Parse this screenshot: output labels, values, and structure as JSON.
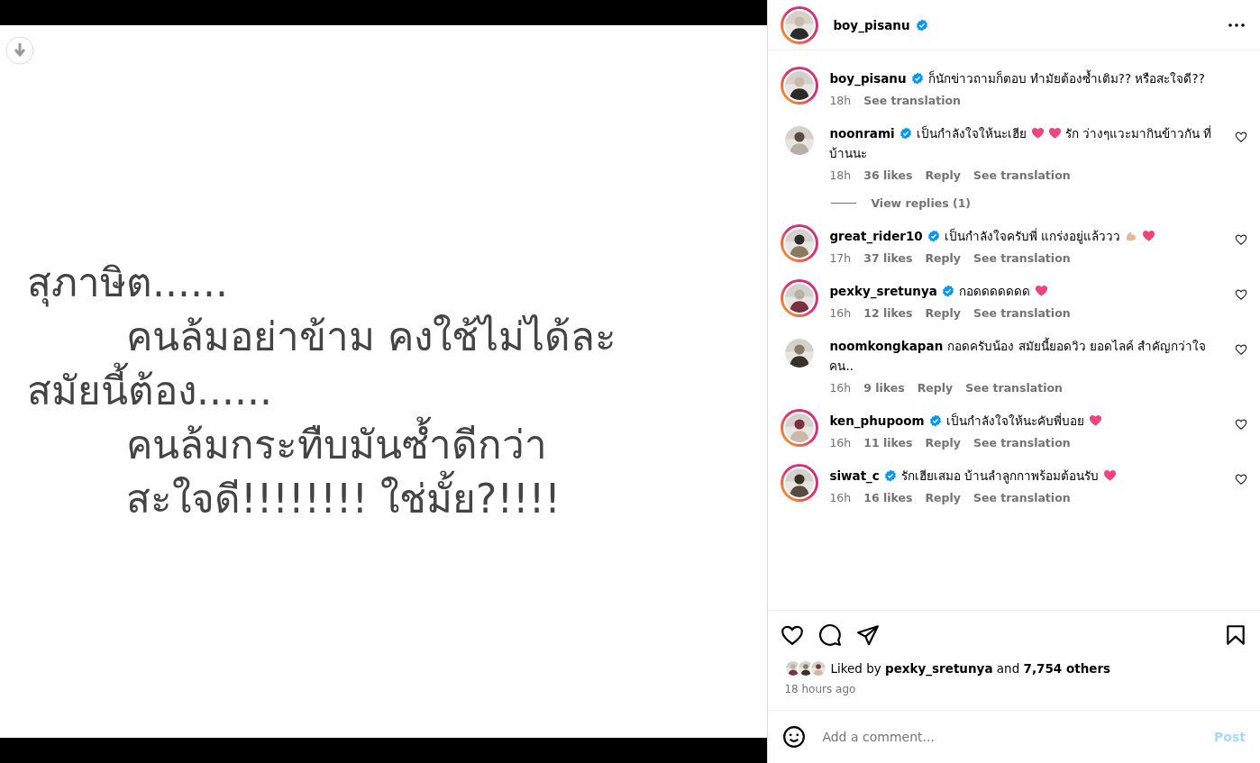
{
  "post_image": {
    "lines": [
      {
        "text": "สุภาษิต......",
        "indent": false
      },
      {
        "text": "คนล้มอย่าข้าม คงใช้ไม่ได้ละ",
        "indent": true
      },
      {
        "text": "สมัยนี้ต้อง......",
        "indent": false
      },
      {
        "text": "คนล้มกระทืบมันซ้ำดีกว่า",
        "indent": true
      },
      {
        "text": "สะใจดี!!!!!!!! ใช่มั้ย?!!!!",
        "indent": true
      }
    ]
  },
  "header": {
    "username": "boy_pisanu",
    "verified": true,
    "story_ring": true
  },
  "caption": {
    "username": "boy_pisanu",
    "verified": true,
    "story_ring": true,
    "parts": [
      {
        "kind": "text",
        "text": "ก็นักข่าวถามก็ตอบ ทำมัยต้องซ้ำเติม?? หรือสะใจดี??"
      }
    ],
    "time": "18h",
    "see_translation": "See translation"
  },
  "comments": [
    {
      "username": "noonrami",
      "verified": true,
      "story_ring": false,
      "parts": [
        {
          "kind": "text",
          "text": "เป็นกำลังใจให้นะเฮีย"
        },
        {
          "kind": "heart"
        },
        {
          "kind": "heart"
        },
        {
          "kind": "text",
          "text": "รัก ว่างๆแวะมากินข้าวกัน ที่บ้านนะ"
        }
      ],
      "time": "18h",
      "likes": "36 likes",
      "reply": "Reply",
      "see_translation": "See translation",
      "view_replies": "View replies (1)"
    },
    {
      "username": "great_rider10",
      "verified": true,
      "story_ring": true,
      "parts": [
        {
          "kind": "text",
          "text": "เป็นกำลังใจครับพี่ แกร่งอยู่แล้ววว"
        },
        {
          "kind": "muscle"
        },
        {
          "kind": "heart"
        }
      ],
      "time": "17h",
      "likes": "37 likes",
      "reply": "Reply",
      "see_translation": "See translation"
    },
    {
      "username": "pexky_sretunya",
      "verified": true,
      "story_ring": true,
      "parts": [
        {
          "kind": "text",
          "text": "กอดดดดดดด"
        },
        {
          "kind": "heart"
        }
      ],
      "time": "16h",
      "likes": "12 likes",
      "reply": "Reply",
      "see_translation": "See translation"
    },
    {
      "username": "noomkongkapan",
      "verified": false,
      "story_ring": false,
      "parts": [
        {
          "kind": "text",
          "text": "กอดครับน้อง สมัยนี้ยอดวิว ยอดไลค์ สำคัญกว่าใจคน.."
        }
      ],
      "time": "16h",
      "likes": "9 likes",
      "reply": "Reply",
      "see_translation": "See translation"
    },
    {
      "username": "ken_phupoom",
      "verified": true,
      "story_ring": true,
      "parts": [
        {
          "kind": "text",
          "text": "เป็นกำลังใจให้นะคับพี่บอย"
        },
        {
          "kind": "heart"
        }
      ],
      "time": "16h",
      "likes": "11 likes",
      "reply": "Reply",
      "see_translation": "See translation"
    },
    {
      "username": "siwat_c",
      "verified": true,
      "story_ring": true,
      "parts": [
        {
          "kind": "text",
          "text": "รักเฮียเสมอ บ้านลำลูกกาพร้อมต้อนรับ"
        },
        {
          "kind": "heart"
        }
      ],
      "time": "16h",
      "likes": "16 likes",
      "reply": "Reply",
      "see_translation": "See translation"
    }
  ],
  "liked_by": {
    "prefix": "Liked by",
    "user": "pexky_sretunya",
    "middle": "and",
    "others": "7,754 others"
  },
  "time_ago": "18 hours ago",
  "comment_box": {
    "placeholder": "Add a comment...",
    "post": "Post",
    "disabled": true
  }
}
